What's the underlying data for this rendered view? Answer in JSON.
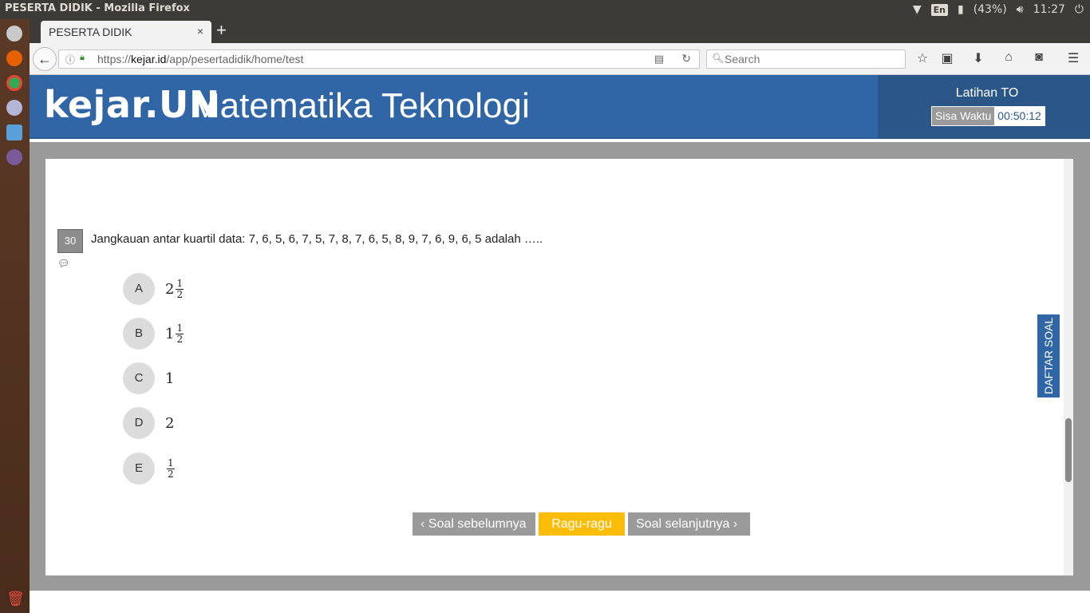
{
  "os": {
    "window_title": "PESERTA DIDIK - Mozilla Firefox",
    "keyboard_layout": "En",
    "battery": "(43%)",
    "clock": "11:27"
  },
  "browser": {
    "tab_title": "PESERTA DIDIK",
    "tab_close": "×",
    "new_tab": "+",
    "url_prefix": "https://",
    "url_domain": "kejar.id",
    "url_path": "/app/pesertadidik/home/test",
    "search_placeholder": "Search"
  },
  "header": {
    "brand": "kejar.UN",
    "subject": "Matematika Teknologi",
    "mode": "Latihan TO",
    "timer_label": "Sisa Waktu",
    "timer_value": "00:50:12"
  },
  "question": {
    "number": "30",
    "text": "Jangkauan antar kuartil data: 7, 6, 5, 6, 7, 5, 7, 8, 7, 6, 5, 8, 9, 7, 6, 9, 6, 5 adalah …..",
    "options": [
      {
        "letter": "A",
        "whole": "2",
        "num": "1",
        "den": "2"
      },
      {
        "letter": "B",
        "whole": "1",
        "num": "1",
        "den": "2"
      },
      {
        "letter": "C",
        "whole": "1",
        "num": "",
        "den": ""
      },
      {
        "letter": "D",
        "whole": "2",
        "num": "",
        "den": ""
      },
      {
        "letter": "E",
        "whole": "",
        "num": "1",
        "den": "2"
      }
    ]
  },
  "nav": {
    "prev": "‹ Soal sebelumnya",
    "doubt": "Ragu-ragu",
    "next": "Soal selanjutnya ›",
    "list": "DAFTAR SOAL"
  },
  "colors": {
    "header_blue": "#3066a6",
    "timer_panel": "#2a5788",
    "doubt_yellow": "#fbbd08",
    "nav_gray": "#9a9a9a"
  }
}
